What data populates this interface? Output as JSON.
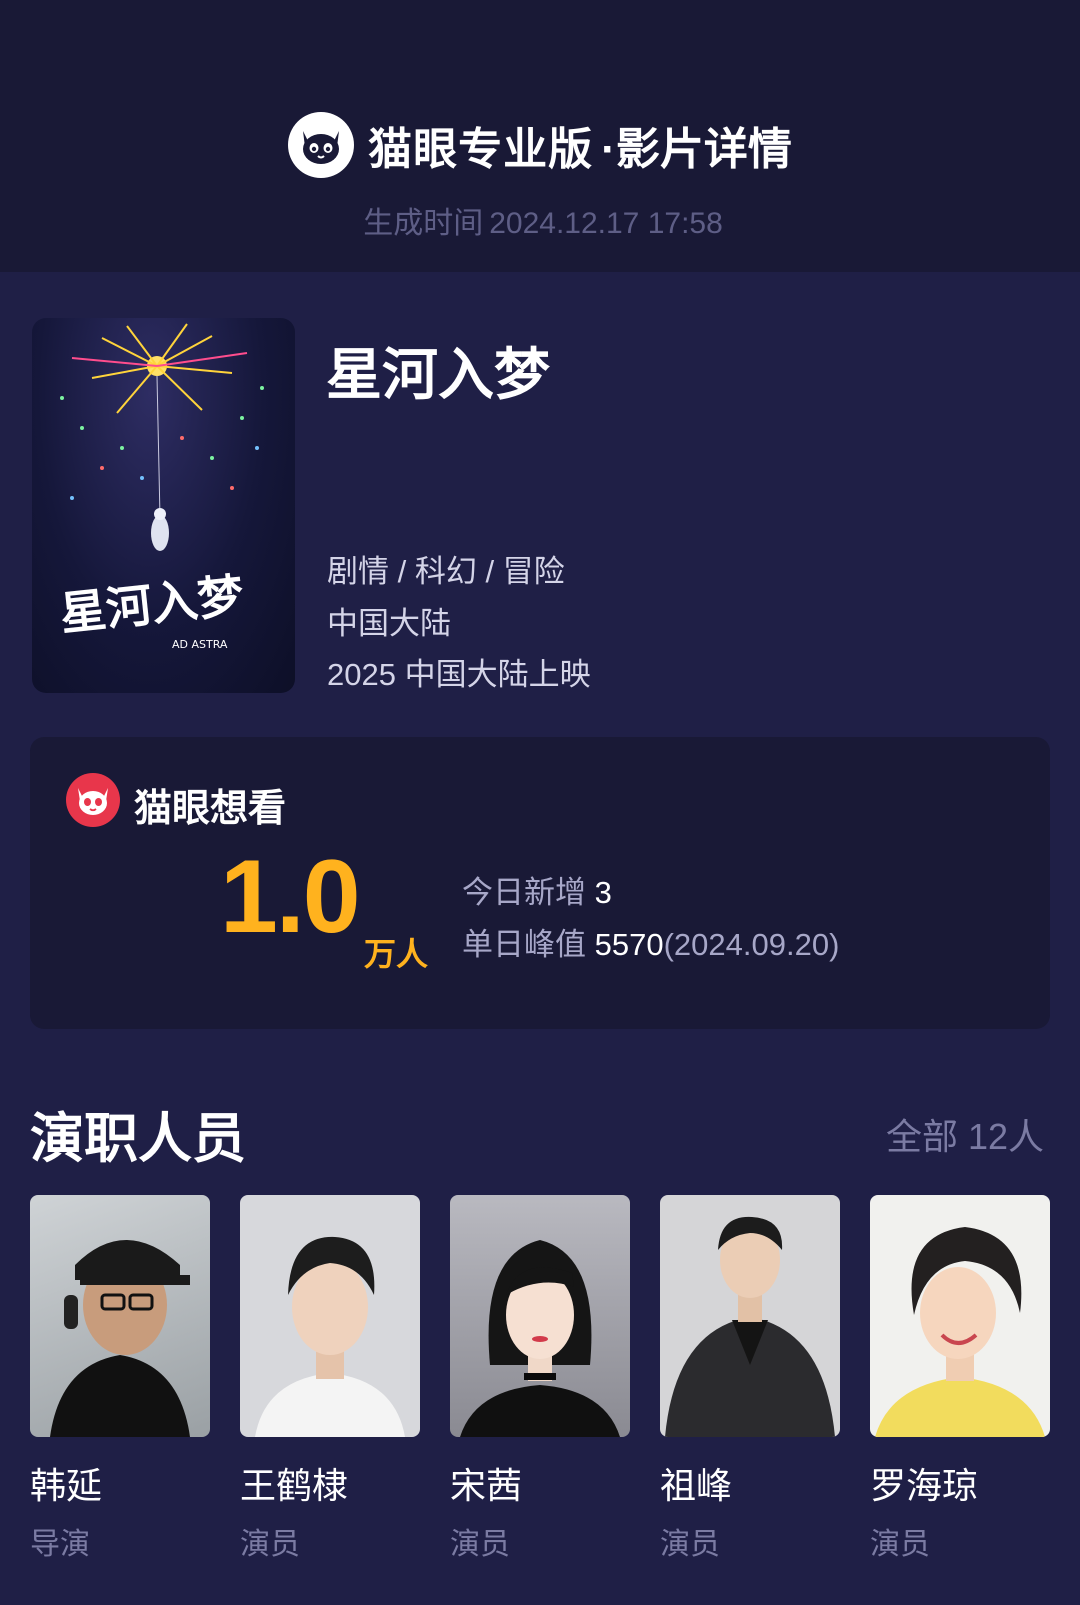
{
  "header": {
    "brand": "猫眼专业版",
    "subtitle": "·影片详情",
    "generated_label": "生成时间",
    "generated_time": "2024.12.17 17:58",
    "logo_icon": "cat-face-icon"
  },
  "movie": {
    "title": "星河入梦",
    "poster_title": "星河入梦",
    "poster_subtitle": "AD ASTRA",
    "genres": "剧情 / 科幻 / 冒险",
    "region": "中国大陆",
    "release": "2025 中国大陆上映"
  },
  "want": {
    "title": "猫眼想看",
    "value": "1.0",
    "unit": "万人",
    "today_label": "今日新增",
    "today_value": "3",
    "peak_label": "单日峰值",
    "peak_value": "5570",
    "peak_date": "(2024.09.20)",
    "icon": "cat-face-icon"
  },
  "cast": {
    "title": "演职人员",
    "all_label": "全部",
    "all_count": "12人",
    "members": [
      {
        "name": "韩延",
        "role": "导演"
      },
      {
        "name": "王鹤棣",
        "role": "演员"
      },
      {
        "name": "宋茜",
        "role": "演员"
      },
      {
        "name": "祖峰",
        "role": "演员"
      },
      {
        "name": "罗海琼",
        "role": "演员"
      }
    ]
  },
  "colors": {
    "background": "#1f1f46",
    "header_bg": "#191936",
    "accent": "#ffb21e",
    "maoyan_red": "#e8364b",
    "muted_text": "#7b7ba3"
  }
}
